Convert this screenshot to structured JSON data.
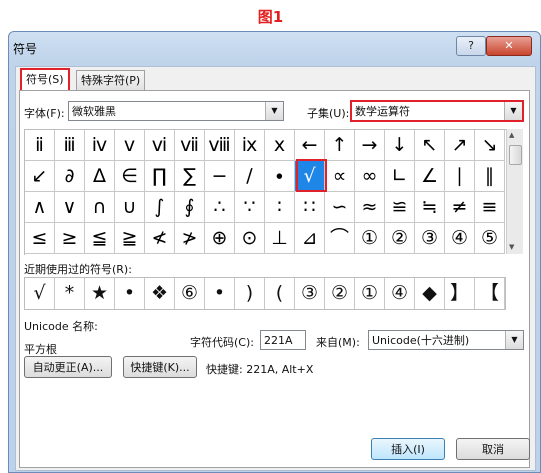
{
  "figure_title": "图1",
  "window": {
    "title": "符号",
    "help_label": "?",
    "close_label": "✕"
  },
  "tabs": [
    {
      "label": "符号(S)"
    },
    {
      "label": "特殊字符(P)"
    }
  ],
  "font": {
    "label": "字体(F):",
    "value": "微软雅黑"
  },
  "subset": {
    "label": "子集(U):",
    "value": "数学运算符"
  },
  "symbols": [
    [
      "ⅱ",
      "ⅲ",
      "ⅳ",
      "ⅴ",
      "ⅵ",
      "ⅶ",
      "ⅷ",
      "ⅸ",
      "ⅹ",
      "←",
      "↑",
      "→",
      "↓",
      "↖",
      "↗",
      "↘"
    ],
    [
      "↙",
      "∂",
      "∆",
      "∈",
      "∏",
      "∑",
      "−",
      "∕",
      "∙",
      "√",
      "∝",
      "∞",
      "∟",
      "∠",
      "∣",
      "∥"
    ],
    [
      "∧",
      "∨",
      "∩",
      "∪",
      "∫",
      "∮",
      "∴",
      "∵",
      "∶",
      "∷",
      "∽",
      "≈",
      "≌",
      "≒",
      "≠",
      "≡"
    ],
    [
      "≤",
      "≥",
      "≦",
      "≧",
      "≮",
      "≯",
      "⊕",
      "⊙",
      "⊥",
      "⊿",
      "⌒",
      "①",
      "②",
      "③",
      "④",
      "⑤"
    ]
  ],
  "selected_symbol": "√",
  "recent": {
    "label": "近期使用过的符号(R):",
    "symbols": [
      "√",
      "*",
      "★",
      "•",
      "❖",
      "⑥",
      "•",
      ")",
      "(",
      "③",
      "②",
      "①",
      "④",
      "◆",
      "】",
      "【"
    ]
  },
  "unicode_name": {
    "label": "Unicode 名称:",
    "value": "平方根"
  },
  "char_code": {
    "label": "字符代码(C):",
    "value": "221A"
  },
  "from": {
    "label": "来自(M):",
    "value": "Unicode(十六进制)"
  },
  "autocorrect_label": "自动更正(A)...",
  "shortcut_key_label": "快捷键(K)...",
  "shortcut_text": "快捷键: 221A, Alt+X",
  "insert_label": "插入(I)",
  "cancel_label": "取消"
}
